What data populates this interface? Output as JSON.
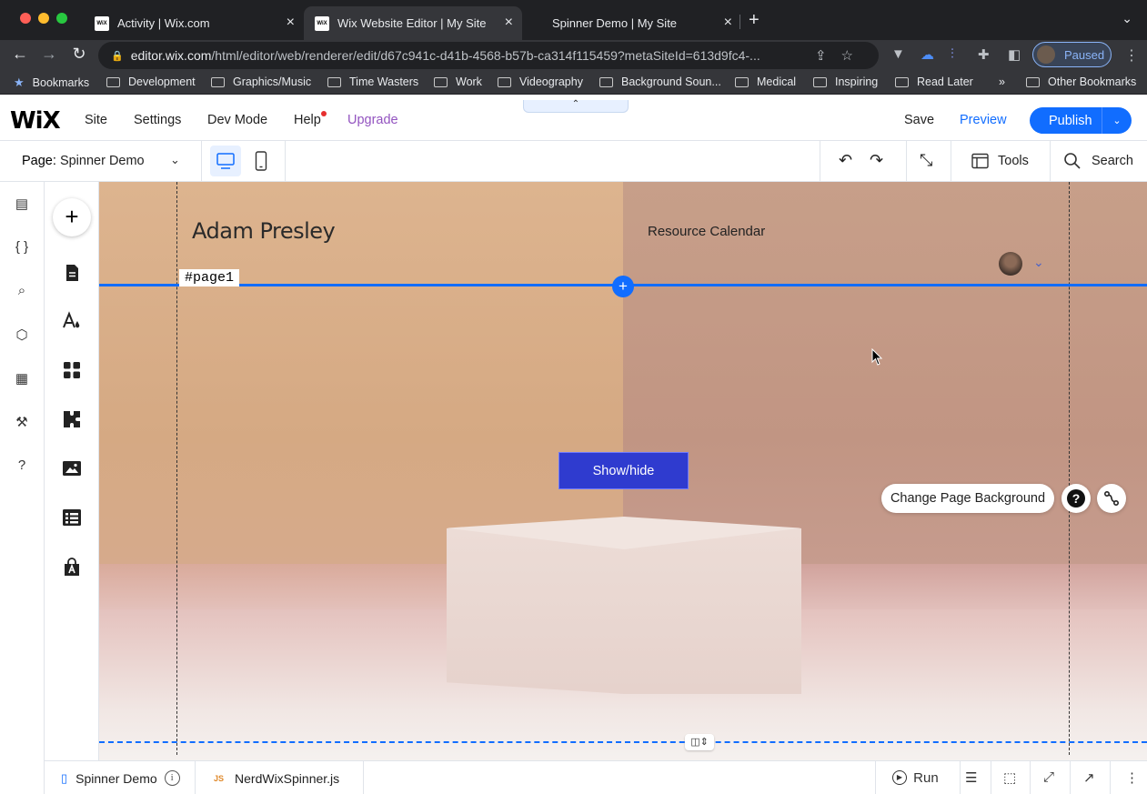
{
  "browser": {
    "tabs": [
      {
        "title": "Activity | Wix.com",
        "favicon": "WiX"
      },
      {
        "title": "Wix Website Editor | My Site",
        "favicon": "WiX"
      },
      {
        "title": "Spinner Demo | My Site",
        "favicon": ""
      }
    ],
    "url_host": "editor.wix.com",
    "url_path": "/html/editor/web/renderer/edit/d67c941c-d41b-4568-b57b-ca314f115459?metaSiteId=613d9fc4-...",
    "profile_label": "Paused",
    "bookmarks": [
      "Bookmarks",
      "Development",
      "Graphics/Music",
      "Time Wasters",
      "Work",
      "Videography",
      "Background Soun...",
      "Medical",
      "Inspiring",
      "Read Later"
    ],
    "overflow": "»",
    "other_bookmarks": "Other Bookmarks"
  },
  "editor": {
    "logo": "WiX",
    "menu": [
      "Site",
      "Settings",
      "Dev Mode",
      "Help",
      "Upgrade"
    ],
    "save": "Save",
    "preview": "Preview",
    "publish": "Publish",
    "page_prefix": "Page:",
    "page_name": "Spinner Demo",
    "tools": "Tools",
    "search": "Search",
    "accent": "#116dff"
  },
  "canvas": {
    "site_name": "Adam Presley",
    "nav_link": "Resource Calendar",
    "page_anchor": "#page1",
    "button_label": "Show/hide",
    "change_bg": "Change Page Background",
    "help_glyph": "?"
  },
  "devbar": {
    "page_tab": "Spinner Demo",
    "file_tab": "NerdWixSpinner.js",
    "js_badge": "JS",
    "run": "Run"
  }
}
